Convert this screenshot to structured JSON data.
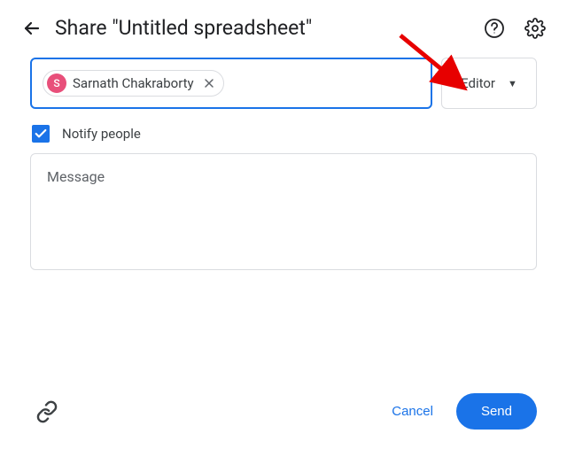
{
  "header": {
    "title": "Share \"Untitled spreadsheet\""
  },
  "recipients": {
    "chip": {
      "initial": "S",
      "name": "Sarnath Chakraborty"
    }
  },
  "role": {
    "selected": "Editor"
  },
  "notify": {
    "label": "Notify people",
    "checked": true
  },
  "message": {
    "placeholder": "Message"
  },
  "footer": {
    "cancel": "Cancel",
    "send": "Send"
  }
}
